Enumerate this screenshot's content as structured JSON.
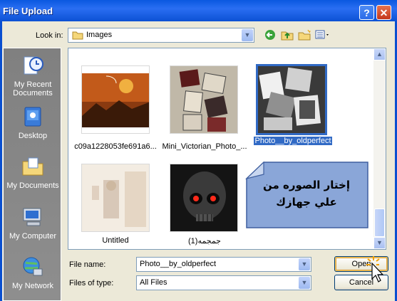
{
  "window": {
    "title": "File Upload",
    "help_label": "?",
    "close_label": "✕"
  },
  "lookin": {
    "label": "Look in:",
    "value": "Images"
  },
  "toolbar": {
    "back": "back-icon",
    "up": "up-folder-icon",
    "newfolder": "new-folder-icon",
    "views": "views-menu-icon"
  },
  "places": [
    {
      "label": "My Recent Documents",
      "icon": "recent-documents-icon"
    },
    {
      "label": "Desktop",
      "icon": "desktop-icon"
    },
    {
      "label": "My Documents",
      "icon": "my-documents-icon"
    },
    {
      "label": "My Computer",
      "icon": "my-computer-icon"
    },
    {
      "label": "My Network",
      "icon": "my-network-icon"
    }
  ],
  "files": [
    {
      "name": "c09a1228053fe691a6...",
      "selected": false
    },
    {
      "name": "Mini_Victorian_Photo_...",
      "selected": false
    },
    {
      "name": "Photo__by_oldperfect",
      "selected": true
    },
    {
      "name": "Untitled",
      "selected": false
    },
    {
      "name": "(جمجمه(1",
      "selected": false
    }
  ],
  "callout": {
    "line1": "إختار الصوره من",
    "line2": "علي جهازك"
  },
  "filename": {
    "label": "File name:",
    "value": "Photo__by_oldperfect"
  },
  "filetype": {
    "label": "Files of type:",
    "value": "All Files"
  },
  "buttons": {
    "open": "Open",
    "cancel": "Cancel"
  }
}
